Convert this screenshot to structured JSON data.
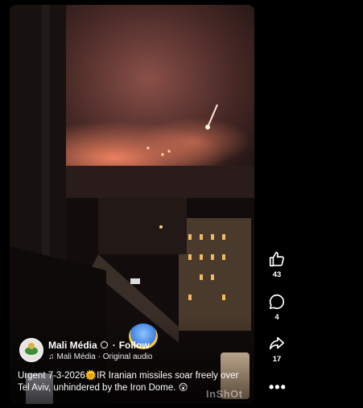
{
  "post": {
    "author": "Mali Média",
    "follow": "Follow",
    "separator": "·",
    "audio": "Mali Média · Original audio",
    "caption": "Urgent 7-3-2026🌞IR Iranian missiles soar freely over Tel Aviv, unhindered by the Iron Dome. 😲",
    "watermark": "InShOt"
  },
  "actions": {
    "likes": "43",
    "comments": "4",
    "shares": "17"
  },
  "icons": {
    "like": "thumbs-up-icon",
    "comment": "speech-bubble-icon",
    "share": "share-arrow-icon",
    "more": "more-dots-icon",
    "audio": "music-note-icon",
    "globe": "globe-icon"
  },
  "colors": {
    "background": "#000000",
    "text": "#ffffff"
  }
}
